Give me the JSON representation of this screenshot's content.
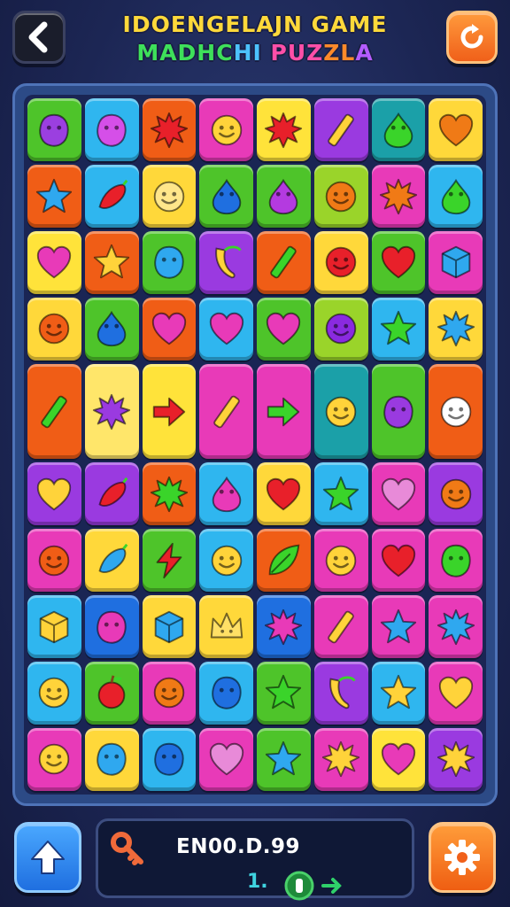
{
  "header": {
    "title_line1": "IDOENGELAJN GAME",
    "title_line2_parts": [
      {
        "text": "MADHC",
        "color": "#3ee05a"
      },
      {
        "text": "HI",
        "color": "#4cc2ff"
      },
      {
        "text": " PUZ",
        "color": "#ff4fa8"
      },
      {
        "text": "ZL",
        "color": "#ff8a2a"
      },
      {
        "text": "A",
        "color": "#b45cff"
      }
    ],
    "back_icon": "chevron-left-icon",
    "refresh_icon": "refresh-icon"
  },
  "board": {
    "rows": [
      [
        {
          "bg": "#4ec42a",
          "icon": "blob",
          "color": "#9b3fe0"
        },
        {
          "bg": "#2fb6ef",
          "icon": "blob",
          "color": "#d54fe8"
        },
        {
          "bg": "#f05d16",
          "icon": "splat",
          "color": "#e8202a"
        },
        {
          "bg": "#e83ab8",
          "icon": "smiley",
          "color": "#ffd33a"
        },
        {
          "bg": "#ffe33a",
          "icon": "splat",
          "color": "#e8202a"
        },
        {
          "bg": "#9a3ae0",
          "icon": "stick",
          "color": "#ffd33a"
        },
        {
          "bg": "#1ba0a8",
          "icon": "drop",
          "color": "#3ad42a"
        },
        {
          "bg": "#ffd83a",
          "icon": "heart",
          "color": "#f07a16"
        }
      ],
      [
        {
          "bg": "#f05d16",
          "icon": "star",
          "color": "#2fa8ef"
        },
        {
          "bg": "#2fb6ef",
          "icon": "pepper",
          "color": "#e8202a"
        },
        {
          "bg": "#ffd83a",
          "icon": "smiley",
          "color": "#ffe68a"
        },
        {
          "bg": "#4ec42a",
          "icon": "drop",
          "color": "#1f6fe0"
        },
        {
          "bg": "#4ec42a",
          "icon": "drop",
          "color": "#b43ae0"
        },
        {
          "bg": "#9ad42a",
          "icon": "smiley",
          "color": "#f07a16"
        },
        {
          "bg": "#e83ab8",
          "icon": "splat",
          "color": "#f07a16"
        },
        {
          "bg": "#2fb6ef",
          "icon": "drop",
          "color": "#3ad42a"
        }
      ],
      [
        {
          "bg": "#ffe33a",
          "icon": "heart",
          "color": "#e83ab8"
        },
        {
          "bg": "#f05d16",
          "icon": "star",
          "color": "#ffd33a"
        },
        {
          "bg": "#4ec42a",
          "icon": "blob",
          "color": "#2fa8ef"
        },
        {
          "bg": "#9a3ae0",
          "icon": "banana",
          "color": "#ffd33a"
        },
        {
          "bg": "#f05d16",
          "icon": "stick",
          "color": "#3ad42a"
        },
        {
          "bg": "#ffd83a",
          "icon": "smiley",
          "color": "#e8202a"
        },
        {
          "bg": "#4ec42a",
          "icon": "heart",
          "color": "#e8202a"
        },
        {
          "bg": "#e83ab8",
          "icon": "cube",
          "color": "#2fa8ef"
        }
      ],
      [
        {
          "bg": "#ffd83a",
          "icon": "smiley",
          "color": "#f05d16"
        },
        {
          "bg": "#4ec42a",
          "icon": "drop",
          "color": "#1f6fe0"
        },
        {
          "bg": "#f05d16",
          "icon": "heart",
          "color": "#e83ab8"
        },
        {
          "bg": "#2fb6ef",
          "icon": "heart",
          "color": "#e83ab8"
        },
        {
          "bg": "#4ec42a",
          "icon": "heart",
          "color": "#e83ab8"
        },
        {
          "bg": "#9ad42a",
          "icon": "smiley",
          "color": "#8a2ae0"
        },
        {
          "bg": "#2fb6ef",
          "icon": "star",
          "color": "#3ad42a"
        },
        {
          "bg": "#ffd83a",
          "icon": "splat",
          "color": "#2fa8ef"
        }
      ],
      [
        {
          "bg": "#f05d16",
          "icon": "stick",
          "color": "#3ad42a",
          "span": 1,
          "tall": true
        },
        {
          "bg": "#ffe66a",
          "icon": "splat",
          "color": "#9a3ae0",
          "span": 1,
          "tall": true
        },
        {
          "bg": "#ffe33a",
          "icon": "arrow",
          "color": "#e8202a",
          "span": 1,
          "tall": true
        },
        {
          "bg": "#e83ab8",
          "icon": "stick",
          "color": "#ffd33a",
          "span": 1,
          "tall": true
        },
        {
          "bg": "#e83ab8",
          "icon": "arrow",
          "color": "#3ad42a",
          "span": 1,
          "tall": true
        },
        {
          "bg": "#1ba0a8",
          "icon": "smiley",
          "color": "#ffd33a",
          "span": 1,
          "tall": true
        },
        {
          "bg": "#4ec42a",
          "icon": "blob",
          "color": "#9a3ae0",
          "span": 1,
          "tall": true
        },
        {
          "bg": "#f05d16",
          "icon": "smiley",
          "color": "#ffffff",
          "span": 1,
          "tall": true
        }
      ],
      [
        {
          "bg": "#9a3ae0",
          "icon": "heart",
          "color": "#ffd33a"
        },
        {
          "bg": "#9a3ae0",
          "icon": "pepper",
          "color": "#e8202a"
        },
        {
          "bg": "#f05d16",
          "icon": "splat",
          "color": "#3ad42a"
        },
        {
          "bg": "#2fb6ef",
          "icon": "drop",
          "color": "#e83ab8"
        },
        {
          "bg": "#ffd83a",
          "icon": "heart",
          "color": "#e8202a"
        },
        {
          "bg": "#2fb6ef",
          "icon": "star",
          "color": "#3ad42a"
        },
        {
          "bg": "#e83ab8",
          "icon": "heart",
          "color": "#e88ad8"
        },
        {
          "bg": "#9a3ae0",
          "icon": "smiley",
          "color": "#f07a16"
        }
      ],
      [
        {
          "bg": "#e83ab8",
          "icon": "smiley",
          "color": "#f05d16"
        },
        {
          "bg": "#ffd83a",
          "icon": "pepper",
          "color": "#2fa8ef"
        },
        {
          "bg": "#4ec42a",
          "icon": "bolt",
          "color": "#e8202a"
        },
        {
          "bg": "#2fb6ef",
          "icon": "smiley",
          "color": "#ffd33a"
        },
        {
          "bg": "#f05d16",
          "icon": "leaf",
          "color": "#3ad42a"
        },
        {
          "bg": "#e83ab8",
          "icon": "smiley",
          "color": "#ffd33a"
        },
        {
          "bg": "#e83ab8",
          "icon": "heart",
          "color": "#e8202a"
        },
        {
          "bg": "#e83ab8",
          "icon": "blob",
          "color": "#3ad42a"
        }
      ],
      [
        {
          "bg": "#2fb6ef",
          "icon": "cube",
          "color": "#ffd33a"
        },
        {
          "bg": "#1f6fe0",
          "icon": "blob",
          "color": "#e83ab8"
        },
        {
          "bg": "#ffd83a",
          "icon": "cube",
          "color": "#2fa8ef"
        },
        {
          "bg": "#ffd83a",
          "icon": "crown",
          "color": "#ffe066"
        },
        {
          "bg": "#1f6fe0",
          "icon": "splat",
          "color": "#e83ab8"
        },
        {
          "bg": "#e83ab8",
          "icon": "stick",
          "color": "#ffd33a"
        },
        {
          "bg": "#e83ab8",
          "icon": "star",
          "color": "#2fa8ef"
        },
        {
          "bg": "#e83ab8",
          "icon": "splat",
          "color": "#2fa8ef"
        }
      ],
      [
        {
          "bg": "#2fb6ef",
          "icon": "smiley",
          "color": "#ffd33a"
        },
        {
          "bg": "#4ec42a",
          "icon": "apple",
          "color": "#e8202a"
        },
        {
          "bg": "#e83ab8",
          "icon": "smiley",
          "color": "#f07a16"
        },
        {
          "bg": "#2fb6ef",
          "icon": "blob",
          "color": "#1f6fe0"
        },
        {
          "bg": "#4ec42a",
          "icon": "star",
          "color": "#3ad42a"
        },
        {
          "bg": "#9a3ae0",
          "icon": "banana",
          "color": "#ffd33a"
        },
        {
          "bg": "#2fb6ef",
          "icon": "star",
          "color": "#ffd33a"
        },
        {
          "bg": "#e83ab8",
          "icon": "heart",
          "color": "#ffd33a"
        }
      ],
      [
        {
          "bg": "#e83ab8",
          "icon": "smiley",
          "color": "#ffd33a"
        },
        {
          "bg": "#ffd83a",
          "icon": "blob",
          "color": "#2fa8ef"
        },
        {
          "bg": "#2fb6ef",
          "icon": "blob",
          "color": "#1f6fe0"
        },
        {
          "bg": "#e83ab8",
          "icon": "heart",
          "color": "#e88ad8"
        },
        {
          "bg": "#4ec42a",
          "icon": "star",
          "color": "#2fa8ef"
        },
        {
          "bg": "#e83ab8",
          "icon": "splat",
          "color": "#ffd33a"
        },
        {
          "bg": "#ffe33a",
          "icon": "heart",
          "color": "#e83ab8"
        },
        {
          "bg": "#9a3ae0",
          "icon": "splat",
          "color": "#ffd33a"
        }
      ]
    ]
  },
  "footer": {
    "up_icon": "arrow-up-icon",
    "settings_icon": "gear-icon",
    "key_icon": "key-icon",
    "score_text": "EN00.D.99",
    "level_text": "1.",
    "coin_icon": "coin-icon",
    "arrow_icon": "arrow-right-icon"
  }
}
